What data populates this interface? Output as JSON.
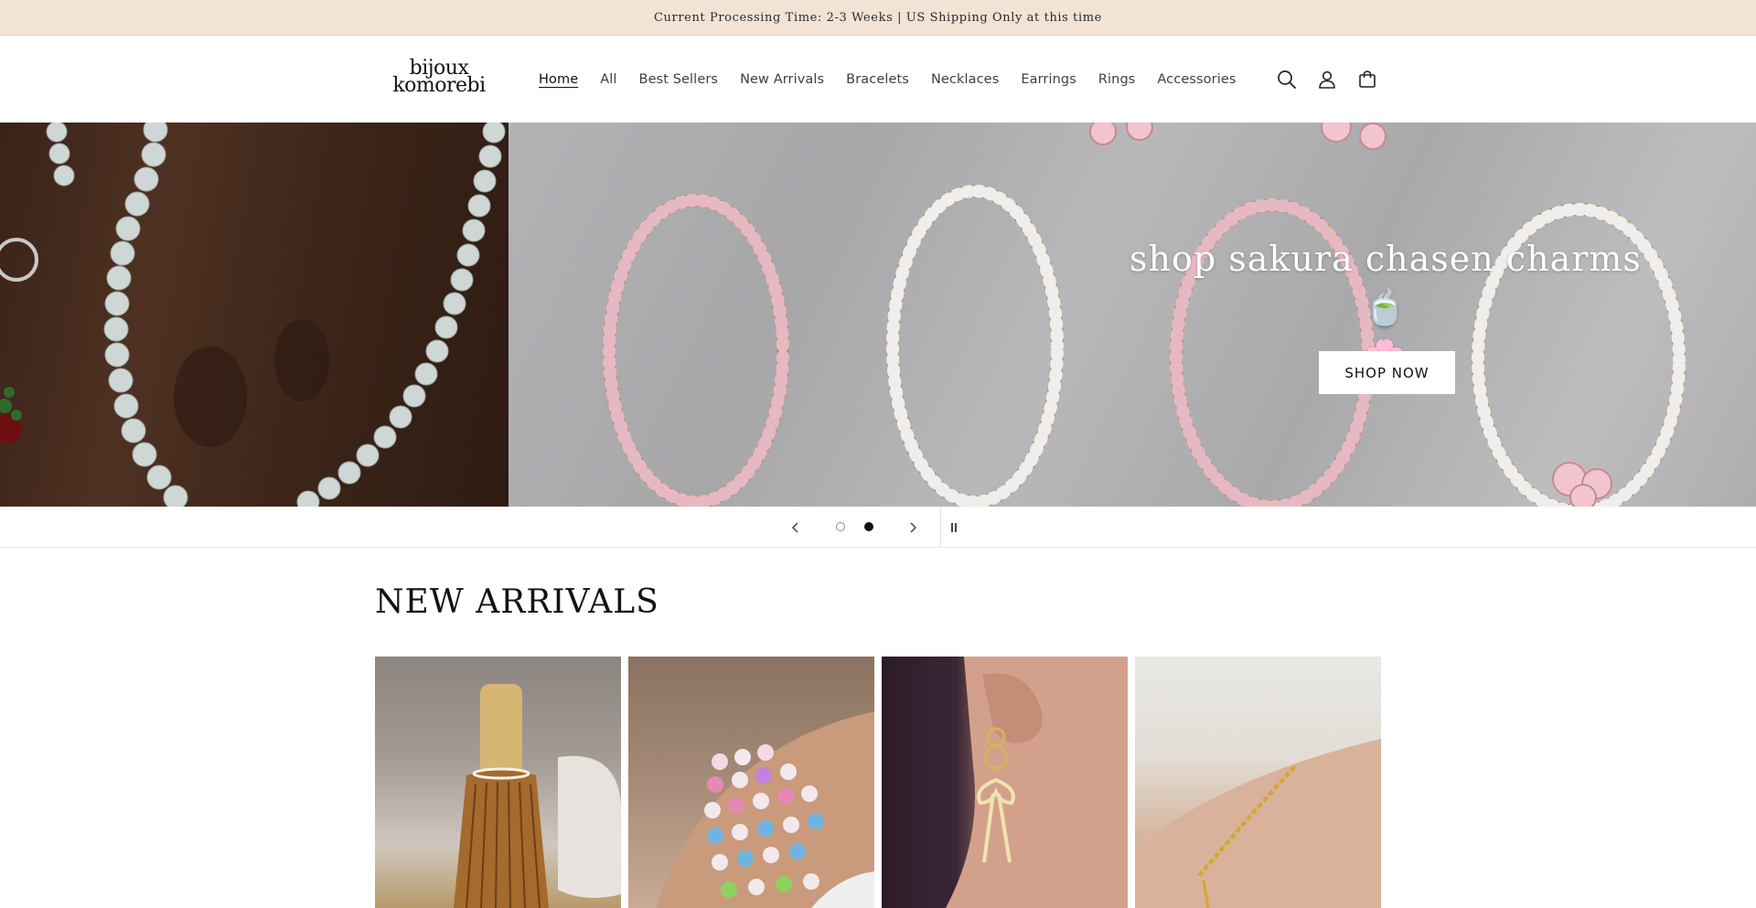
{
  "announcement": "Current Processing Time: 2-3 Weeks | US Shipping Only at this time",
  "logo": {
    "line1": "bijoux",
    "line2": "komorebi"
  },
  "nav": [
    {
      "label": "Home",
      "active": true
    },
    {
      "label": "All"
    },
    {
      "label": "Best Sellers"
    },
    {
      "label": "New Arrivals"
    },
    {
      "label": "Bracelets"
    },
    {
      "label": "Necklaces"
    },
    {
      "label": "Earrings"
    },
    {
      "label": "Rings"
    },
    {
      "label": "Accessories"
    }
  ],
  "header_icons": [
    "search-icon",
    "account-icon",
    "cart-icon"
  ],
  "hero": {
    "heading": "shop sakura chasen charms 🍵",
    "heading_line2": "🌸",
    "button": "SHOP NOW",
    "slides": 2,
    "active_slide": 2
  },
  "slideshow_controls": [
    "chevron-left-icon",
    "chevron-right-icon",
    "pause-icon"
  ],
  "new_arrivals": {
    "title": "NEW ARRIVALS",
    "products": 4
  },
  "colors": {
    "announcement_bg": "#f2e3d5",
    "text": "#121212",
    "hero_bg": "#b3b3b6"
  }
}
